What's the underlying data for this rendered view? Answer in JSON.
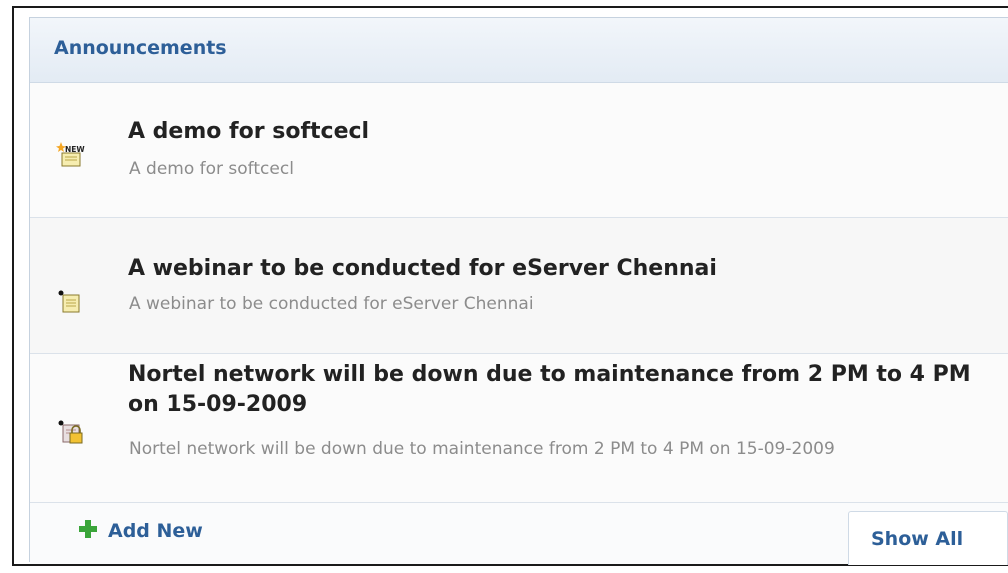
{
  "panel": {
    "title": "Announcements"
  },
  "announcements": [
    {
      "title": "A demo for softcecl",
      "description": "A demo for softcecl",
      "icon": "new-announcement-icon"
    },
    {
      "title": "A webinar to be conducted for eServer Chennai",
      "description": "A webinar to be conducted for eServer Chennai",
      "icon": "announcement-note-icon"
    },
    {
      "title": "Nortel network will be down due to maintenance from 2 PM to 4 PM on 15-09-2009",
      "description": "Nortel network will be down due to maintenance from 2 PM to 4 PM on 15-09-2009",
      "icon": "locked-announcement-icon"
    }
  ],
  "footer": {
    "add_new_label": "Add New",
    "show_all_label": "Show All",
    "add_icon": "plus-icon"
  },
  "colors": {
    "accent": "#2d5f98",
    "header_bg": "#e3ebf4",
    "plus_icon": "#3aa53a"
  }
}
